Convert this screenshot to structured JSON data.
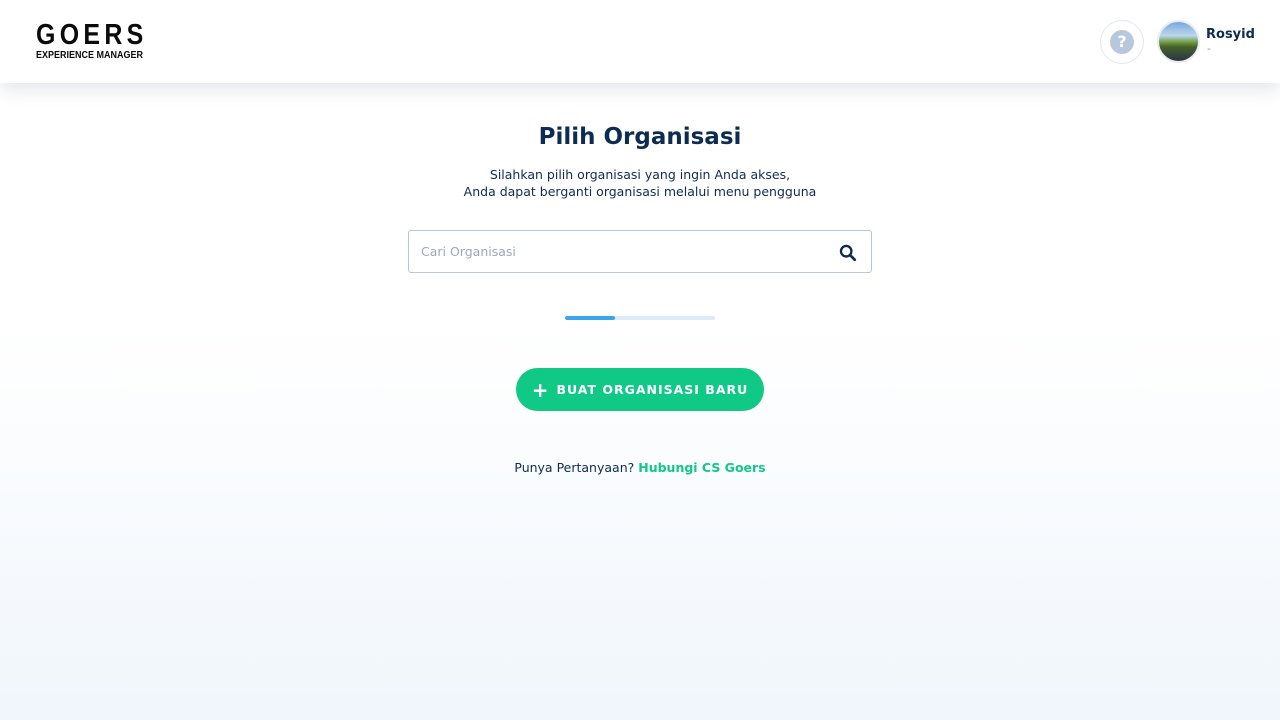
{
  "header": {
    "logo": {
      "main": "GOERS",
      "sub": "EXPERIENCE MANAGER"
    },
    "help_icon": "question-circle-icon",
    "user": {
      "name": "Rosyid",
      "subtitle": "-"
    }
  },
  "main": {
    "title": "Pilih Organisasi",
    "subtitle_line1": "Silahkan pilih organisasi yang ingin Anda akses,",
    "subtitle_line2": "Anda dapat berganti organisasi melalui menu pengguna",
    "search": {
      "placeholder": "Cari Organisasi",
      "value": "",
      "icon": "search-icon"
    },
    "loading_progress": 0.33,
    "create_button": {
      "icon": "plus-icon",
      "label": "BUAT ORGANISASI BARU"
    },
    "footer": {
      "question": "Punya Pertanyaan?",
      "link": "Hubungi CS Goers"
    }
  },
  "colors": {
    "primary": "#0e2c52",
    "accent_green": "#10c987",
    "loader": "#3aa5ea",
    "loader_track": "#dcebf8",
    "help_icon": "#b8c8dc"
  }
}
